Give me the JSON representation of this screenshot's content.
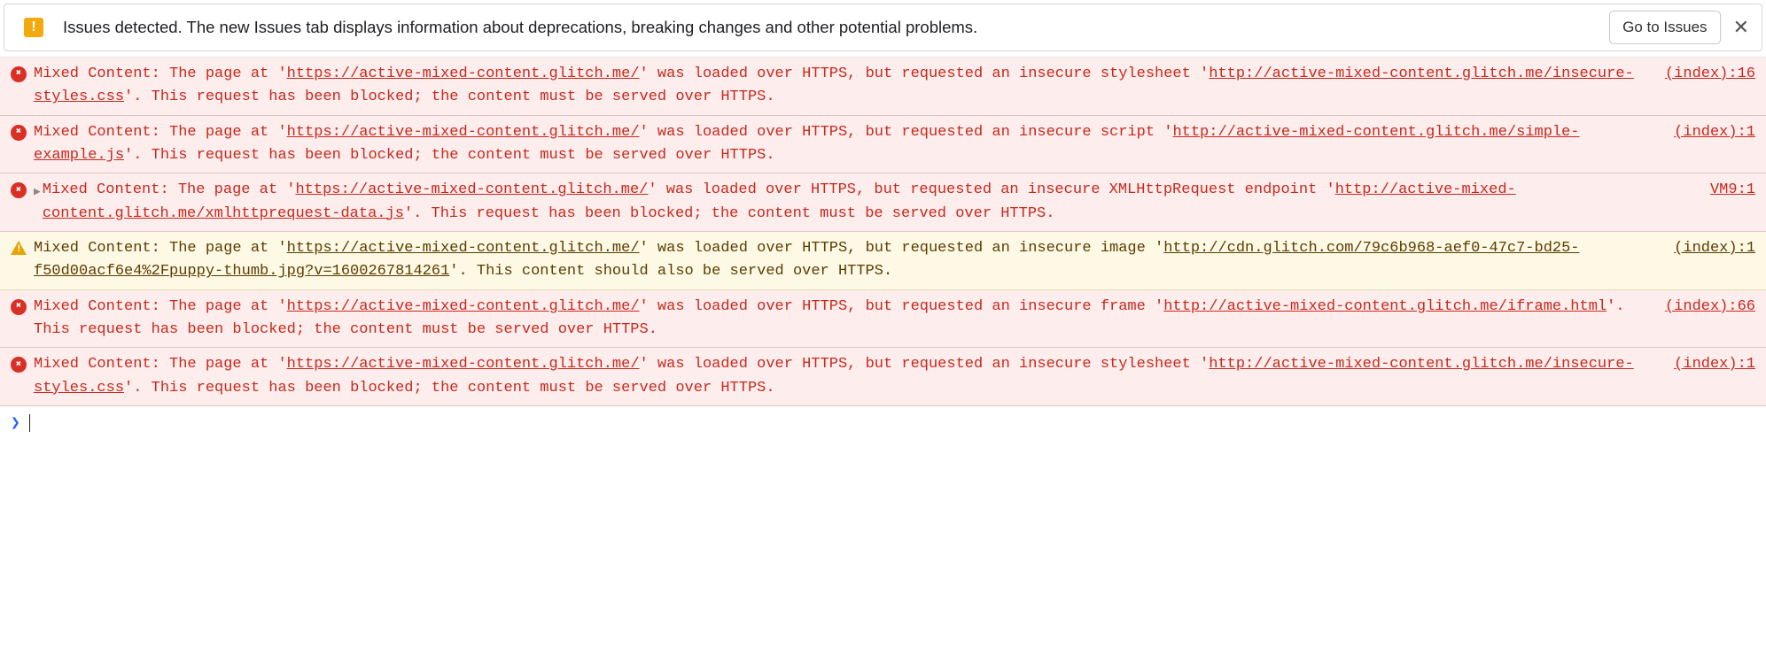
{
  "infobar": {
    "text": "Issues detected. The new Issues tab displays information about deprecations, breaking changes and other potential problems.",
    "button": "Go to Issues",
    "close": "✕"
  },
  "logs": [
    {
      "level": "error",
      "expandable": false,
      "source": "(index):16",
      "parts": [
        {
          "t": "text",
          "v": "Mixed Content: The page at '"
        },
        {
          "t": "url",
          "v": "https://active-mixed-content.glitch.me/"
        },
        {
          "t": "text",
          "v": "' was loaded over HTTPS, but requested an insecure stylesheet '"
        },
        {
          "t": "url",
          "v": "http://active-mixed-content.glitch.me/insecure-styles.css"
        },
        {
          "t": "text",
          "v": "'. This request has been blocked; the content must be served over HTTPS."
        }
      ]
    },
    {
      "level": "error",
      "expandable": false,
      "source": "(index):1",
      "parts": [
        {
          "t": "text",
          "v": "Mixed Content: The page at '"
        },
        {
          "t": "url",
          "v": "https://active-mixed-content.glitch.me/"
        },
        {
          "t": "text",
          "v": "' was loaded over HTTPS, but requested an insecure script '"
        },
        {
          "t": "url",
          "v": "http://active-mixed-content.glitch.me/simple-example.js"
        },
        {
          "t": "text",
          "v": "'. This request has been blocked; the content must be served over HTTPS."
        }
      ]
    },
    {
      "level": "error",
      "expandable": true,
      "source": "VM9:1",
      "parts": [
        {
          "t": "text",
          "v": "Mixed Content: The page at '"
        },
        {
          "t": "url",
          "v": "https://active-mixed-content.glitch.me/"
        },
        {
          "t": "text",
          "v": "' was loaded over HTTPS, but requested an insecure XMLHttpRequest endpoint '"
        },
        {
          "t": "url",
          "v": "http://active-mixed-content.glitch.me/xmlhttprequest-data.js"
        },
        {
          "t": "text",
          "v": "'. This request has been blocked; the content must be served over HTTPS."
        }
      ]
    },
    {
      "level": "warning",
      "expandable": false,
      "source": "(index):1",
      "parts": [
        {
          "t": "text",
          "v": "Mixed Content: The page at '"
        },
        {
          "t": "url",
          "v": "https://active-mixed-content.glitch.me/"
        },
        {
          "t": "text",
          "v": "' was loaded over HTTPS, but requested an insecure image '"
        },
        {
          "t": "url",
          "v": "http://cdn.glitch.com/79c6b968-aef0-47c7-bd25-f50d00acf6e4%2Fpuppy-thumb.jpg?v=1600267814261"
        },
        {
          "t": "text",
          "v": "'. This content should also be served over HTTPS."
        }
      ]
    },
    {
      "level": "error",
      "expandable": false,
      "source": "(index):66",
      "parts": [
        {
          "t": "text",
          "v": "Mixed Content: The page at '"
        },
        {
          "t": "url",
          "v": "https://active-mixed-content.glitch.me/"
        },
        {
          "t": "text",
          "v": "' was loaded over HTTPS, but requested an insecure frame '"
        },
        {
          "t": "url",
          "v": "http://active-mixed-content.glitch.me/iframe.html"
        },
        {
          "t": "text",
          "v": "'. This request has been blocked; the content must be served over HTTPS."
        }
      ]
    },
    {
      "level": "error",
      "expandable": false,
      "source": "(index):1",
      "parts": [
        {
          "t": "text",
          "v": "Mixed Content: The page at '"
        },
        {
          "t": "url",
          "v": "https://active-mixed-content.glitch.me/"
        },
        {
          "t": "text",
          "v": "' was loaded over HTTPS, but requested an insecure stylesheet '"
        },
        {
          "t": "url",
          "v": "http://active-mixed-content.glitch.me/insecure-styles.css"
        },
        {
          "t": "text",
          "v": "'. This request has been blocked; the content must be served over HTTPS."
        }
      ]
    }
  ],
  "prompt": {
    "symbol": "❯"
  }
}
